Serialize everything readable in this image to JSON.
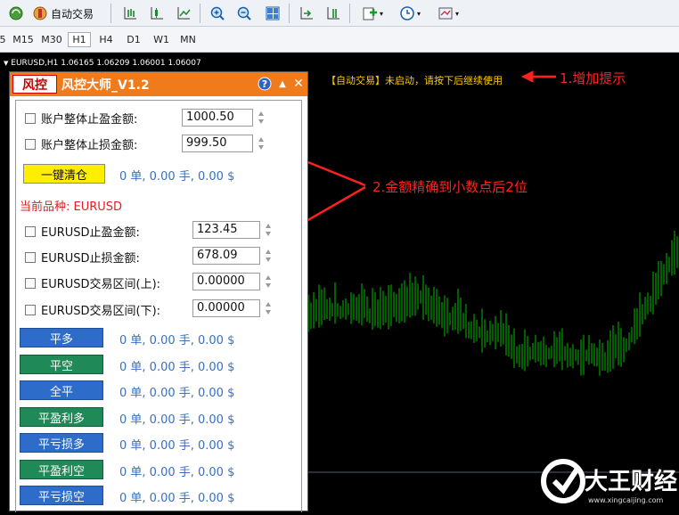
{
  "toolbar": {
    "autotrade_label": "自动交易",
    "icons": [
      "connect-icon",
      "auto-trading-icon",
      "bar-chart-icon",
      "candle-chart-icon",
      "line-chart-icon",
      "zoom-in-icon",
      "zoom-out-icon",
      "tile-windows-icon",
      "autoscroll-icon",
      "chart-shift-icon",
      "indicators-icon",
      "periods-icon",
      "templates-icon"
    ]
  },
  "timeframes": [
    "M15",
    "M30",
    "H1",
    "H4",
    "D1",
    "W1",
    "MN"
  ],
  "active_timeframe": "H1",
  "chart": {
    "ohlc_text": "EURUSD,H1  1.06165 1.06209 1.06001 1.06007",
    "hint_text": "【自动交易】未启动，请按下后继续使用",
    "candle_color": "#00c000"
  },
  "annotations": {
    "a1": "1.增加提示",
    "a2": "2.金额精确到小数点后2位",
    "color": "#ff2020"
  },
  "panel": {
    "logo": "风控",
    "title": "风控大师_V1.2",
    "header_color": "#f07b1c",
    "total_tp_label": "账户整体止盈金额:",
    "total_tp_value": "1000.50",
    "total_sl_label": "账户整体止损金额:",
    "total_sl_value": "999.50",
    "close_all_label": "一键清仓",
    "close_all_status": "0 单, 0.00 手, 0.00 $",
    "current_symbol": "当前品种: EURUSD",
    "sym_tp_label": "EURUSD止盈金额:",
    "sym_tp_value": "123.45",
    "sym_sl_label": "EURUSD止损金额:",
    "sym_sl_value": "678.09",
    "range_up_label": "EURUSD交易区间(上):",
    "range_up_value": "0.00000",
    "range_down_label": "EURUSD交易区间(下):",
    "range_down_value": "0.00000",
    "buttons": [
      {
        "label": "平多",
        "color": "blue",
        "status": "0 单, 0.00 手, 0.00 $"
      },
      {
        "label": "平空",
        "color": "green",
        "status": "0 单, 0.00 手, 0.00 $"
      },
      {
        "label": "全平",
        "color": "blue",
        "status": "0 单, 0.00 手, 0.00 $"
      },
      {
        "label": "平盈利多",
        "color": "green",
        "status": "0 单, 0.00 手, 0.00 $"
      },
      {
        "label": "平亏损多",
        "color": "blue",
        "status": "0 单, 0.00 手, 0.00 $"
      },
      {
        "label": "平盈利空",
        "color": "green",
        "status": "0 单, 0.00 手, 0.00 $"
      },
      {
        "label": "平亏损空",
        "color": "blue",
        "status": "0 单, 0.00 手, 0.00 $"
      }
    ]
  },
  "watermark": {
    "name": "大王财经",
    "url": "www.xingcaijing.com"
  }
}
